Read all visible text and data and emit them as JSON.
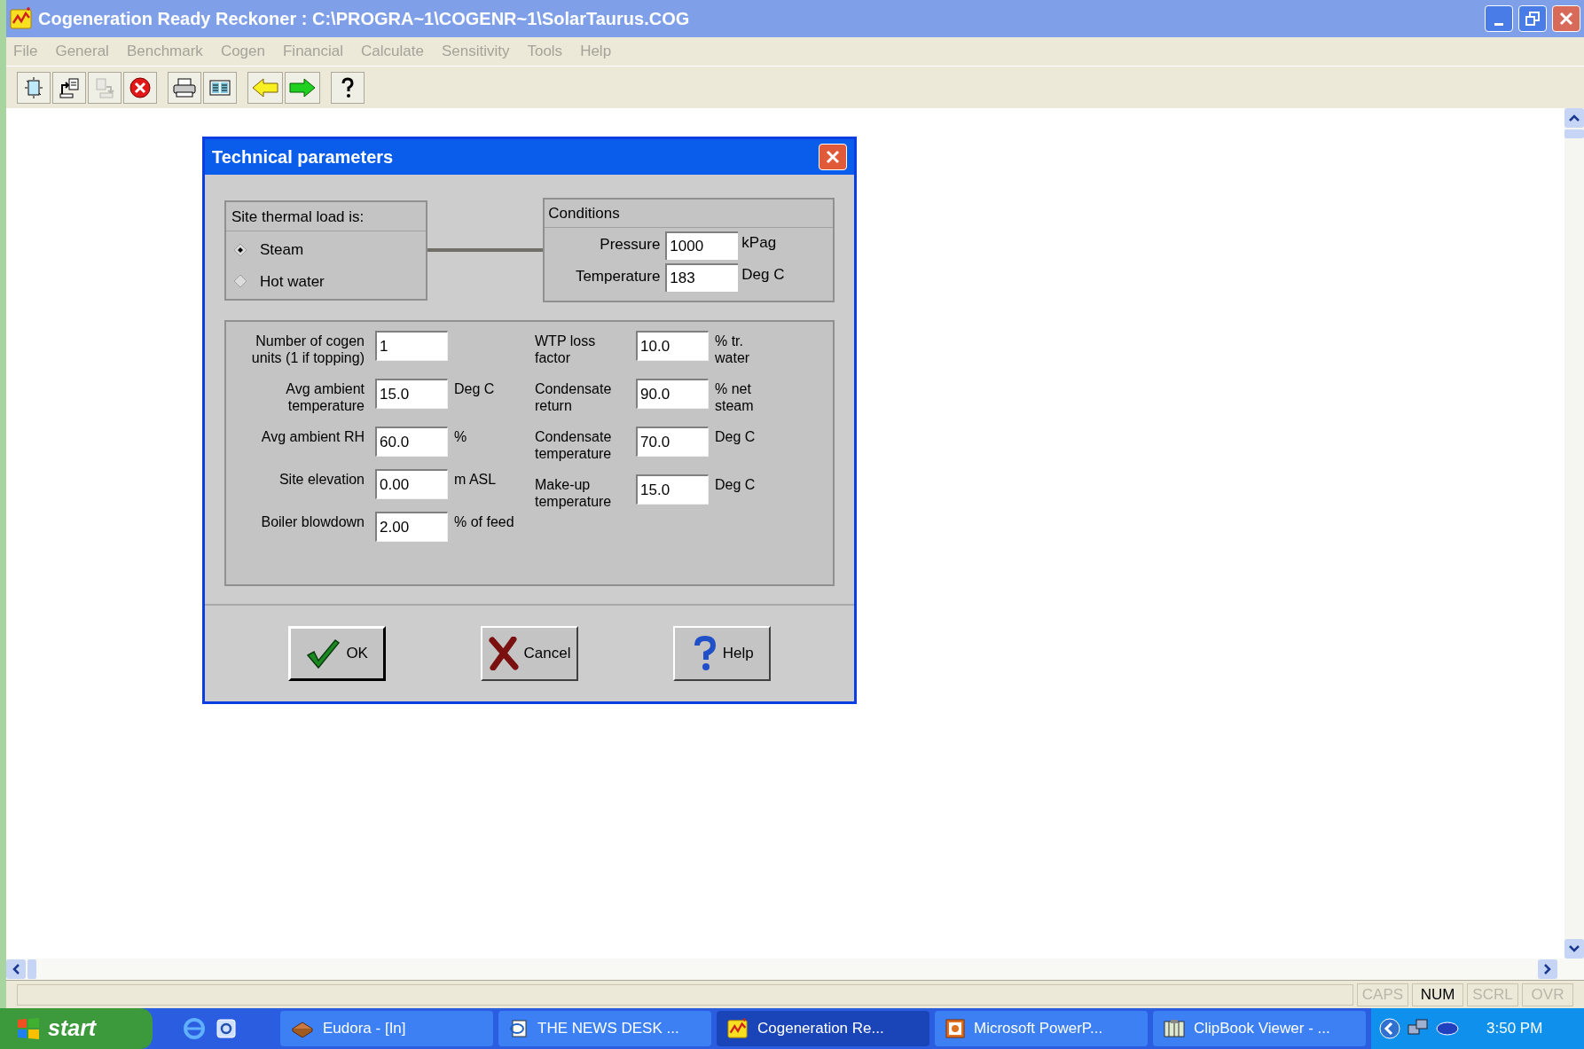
{
  "window": {
    "title": "Cogeneration Ready Reckoner : C:\\PROGRA~1\\COGENR~1\\SolarTaurus.COG"
  },
  "menu": [
    "File",
    "General",
    "Benchmark",
    "Cogen",
    "Financial",
    "Calculate",
    "Sensitivity",
    "Tools",
    "Help"
  ],
  "toolbar": [
    {
      "kind": "new",
      "disabled": false
    },
    {
      "kind": "export",
      "disabled": false
    },
    {
      "kind": "paste",
      "disabled": true
    },
    {
      "kind": "stop",
      "disabled": false
    },
    {
      "kind": "print",
      "disabled": false
    },
    {
      "kind": "grid",
      "disabled": false
    },
    {
      "kind": "back",
      "disabled": false
    },
    {
      "kind": "forward",
      "disabled": false
    },
    {
      "kind": "help",
      "disabled": false
    }
  ],
  "dialog": {
    "title": "Technical parameters",
    "thermal_load": {
      "title": "Site thermal load is:",
      "options": [
        {
          "label": "Steam",
          "selected": true
        },
        {
          "label": "Hot water",
          "selected": false
        }
      ]
    },
    "conditions": {
      "title": "Conditions",
      "fields": [
        {
          "label": "Pressure",
          "value": "1000",
          "unit": "kPag"
        },
        {
          "label": "Temperature",
          "value": "183",
          "unit": "Deg C"
        }
      ]
    },
    "left_fields": [
      {
        "label": "Number of cogen units (1 if topping)",
        "value": "1"
      },
      {
        "label": "Avg ambient temperature",
        "value": "15.0",
        "unit": "Deg C"
      },
      {
        "label": "Avg ambient RH",
        "value": "60.0",
        "unit": "%"
      },
      {
        "label": "Site elevation",
        "value": "0.00",
        "unit": "m ASL"
      },
      {
        "label": "Boiler blowdown",
        "value": "2.00",
        "unit": "% of feed"
      }
    ],
    "right_fields": [
      {
        "label": "WTP loss factor",
        "value": "10.0",
        "unit": "% tr. water"
      },
      {
        "label": "Condensate return",
        "value": "90.0",
        "unit": "% net steam"
      },
      {
        "label": "Condensate temperature",
        "value": "70.0",
        "unit": "Deg C"
      },
      {
        "label": "Make-up temperature",
        "value": "15.0",
        "unit": "Deg C"
      }
    ],
    "buttons": [
      {
        "kind": "ok",
        "label": "OK"
      },
      {
        "kind": "cancel",
        "label": "Cancel"
      },
      {
        "kind": "help",
        "label": "Help"
      }
    ]
  },
  "status_bar": [
    {
      "label": "CAPS",
      "on": false
    },
    {
      "label": "NUM",
      "on": true
    },
    {
      "label": "SCRL",
      "on": false
    },
    {
      "label": "OVR",
      "on": false
    }
  ],
  "taskbar": {
    "start": "start",
    "tasks": [
      {
        "label": "Eudora - [In]",
        "kind": "mail",
        "selected": false
      },
      {
        "label": "THE NEWS DESK ...",
        "kind": "doc",
        "selected": false
      },
      {
        "label": "Cogeneration Re...",
        "kind": "app",
        "selected": true
      },
      {
        "label": "Microsoft PowerP...",
        "kind": "slides",
        "selected": false
      },
      {
        "label": "ClipBook Viewer - ...",
        "kind": "clip",
        "selected": false
      }
    ],
    "clock": "3:50 PM"
  }
}
